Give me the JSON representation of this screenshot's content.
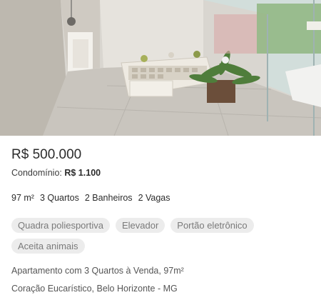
{
  "listing": {
    "photo_icon": "apartment-interior-photo",
    "price": "R$ 500.000",
    "condo_label": "Condomínio:",
    "condo_value": "R$ 1.100",
    "features": [
      "97 m²",
      "3 Quartos",
      "2 Banheiros",
      "2 Vagas"
    ],
    "amenities": [
      "Quadra poliesportiva",
      "Elevador",
      "Portão eletrônico",
      "Aceita animais"
    ],
    "description": "Apartamento com 3 Quartos à Venda, 97m²",
    "address": "Coração Eucarístico, Belo Horizonte - MG"
  }
}
